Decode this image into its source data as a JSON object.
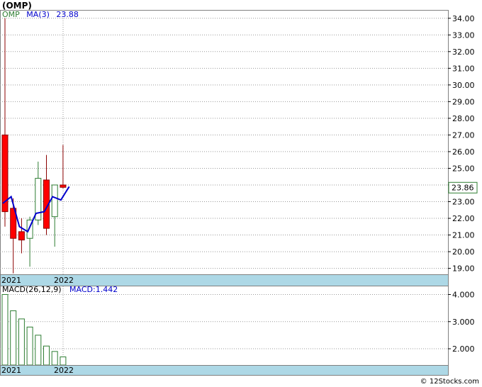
{
  "title": "(OMP)",
  "watermark": "© 12Stocks.com",
  "chart_data": [
    {
      "type": "candlestick",
      "ticker": "OMP",
      "ma_label": "MA(3)",
      "ma_value": "23.88",
      "last_price_label": "23.86",
      "ylim": [
        18.6,
        34.5
      ],
      "yticks": [
        "19.00",
        "20.00",
        "21.00",
        "22.00",
        "23.00",
        "24.00",
        "25.00",
        "26.00",
        "27.00",
        "28.00",
        "29.00",
        "30.00",
        "31.00",
        "32.00",
        "33.00",
        "34.00"
      ],
      "x_labels": [
        "2021",
        "2022"
      ],
      "candles": [
        {
          "o": 27.0,
          "h": 34.0,
          "l": 21.5,
          "c": 22.4
        },
        {
          "o": 22.6,
          "h": 23.2,
          "l": 18.7,
          "c": 20.8
        },
        {
          "o": 21.2,
          "h": 22.0,
          "l": 19.9,
          "c": 20.7
        },
        {
          "o": 20.8,
          "h": 22.1,
          "l": 19.1,
          "c": 21.9
        },
        {
          "o": 21.9,
          "h": 25.4,
          "l": 21.6,
          "c": 24.4
        },
        {
          "o": 24.3,
          "h": 25.8,
          "l": 21.0,
          "c": 21.4
        },
        {
          "o": 22.1,
          "h": 24.0,
          "l": 20.3,
          "c": 24.0
        },
        {
          "o": 24.0,
          "h": 26.4,
          "l": 23.8,
          "c": 23.86
        }
      ],
      "ma": [
        22.9,
        23.3,
        21.5,
        21.2,
        22.3,
        22.4,
        23.3,
        23.1,
        23.9
      ],
      "colors": {
        "up": "#2e7d32",
        "down": "#ff0000",
        "ma": "#0000cc",
        "band": "#add8e6",
        "grid": "#9a9a9a"
      }
    },
    {
      "type": "bar",
      "label": "MACD(26,12,9)",
      "value_label": "MACD:1.442",
      "ylim": [
        1.4,
        4.3
      ],
      "yticks": [
        "2.000",
        "3.000",
        "4.000"
      ],
      "x_labels": [
        "2021",
        "2022"
      ],
      "values": [
        4.0,
        3.4,
        3.1,
        2.8,
        2.5,
        2.1,
        1.9,
        1.7
      ],
      "colors": {
        "bar": "#2e7d32",
        "band": "#add8e6"
      }
    }
  ]
}
